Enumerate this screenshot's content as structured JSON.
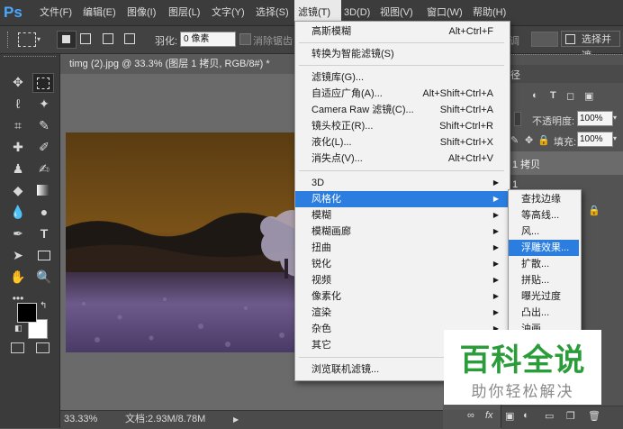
{
  "app": {
    "logo": "Ps"
  },
  "menubar": {
    "items": [
      {
        "label": "文件(F)"
      },
      {
        "label": "编辑(E)"
      },
      {
        "label": "图像(I)"
      },
      {
        "label": "图层(L)"
      },
      {
        "label": "文字(Y)"
      },
      {
        "label": "选择(S)"
      },
      {
        "label": "滤镜(T)"
      },
      {
        "label": "3D(D)"
      },
      {
        "label": "视图(V)"
      },
      {
        "label": "窗口(W)"
      },
      {
        "label": "帮助(H)"
      }
    ]
  },
  "options": {
    "feather_label": "羽化:",
    "feather_value": "0 像素",
    "antialias_label": "消除锯齿",
    "adjust_label": "调",
    "select_mask_button": "选择并遮"
  },
  "document": {
    "tab_title": "timg (2).jpg @ 33.3% (图层 1 拷贝, RGB/8#) *",
    "zoom": "33.33%",
    "doc_info": "文档:2.93M/8.78M"
  },
  "filter_menu": {
    "items": [
      {
        "label": "高斯模糊",
        "shortcut": "Alt+Ctrl+F"
      },
      {
        "label": "转换为智能滤镜(S)",
        "shortcut": ""
      },
      {
        "label": "滤镜库(G)...",
        "shortcut": ""
      },
      {
        "label": "自适应广角(A)...",
        "shortcut": "Alt+Shift+Ctrl+A"
      },
      {
        "label": "Camera Raw 滤镜(C)...",
        "shortcut": "Shift+Ctrl+A"
      },
      {
        "label": "镜头校正(R)...",
        "shortcut": "Shift+Ctrl+R"
      },
      {
        "label": "液化(L)...",
        "shortcut": "Shift+Ctrl+X"
      },
      {
        "label": "消失点(V)...",
        "shortcut": "Alt+Ctrl+V"
      },
      {
        "label": "3D",
        "shortcut": ""
      },
      {
        "label": "风格化",
        "shortcut": ""
      },
      {
        "label": "模糊",
        "shortcut": ""
      },
      {
        "label": "模糊画廊",
        "shortcut": ""
      },
      {
        "label": "扭曲",
        "shortcut": ""
      },
      {
        "label": "锐化",
        "shortcut": ""
      },
      {
        "label": "视频",
        "shortcut": ""
      },
      {
        "label": "像素化",
        "shortcut": ""
      },
      {
        "label": "渲染",
        "shortcut": ""
      },
      {
        "label": "杂色",
        "shortcut": ""
      },
      {
        "label": "其它",
        "shortcut": ""
      },
      {
        "label": "浏览联机滤镜...",
        "shortcut": ""
      }
    ]
  },
  "stylize_submenu": {
    "items": [
      {
        "label": "查找边缘"
      },
      {
        "label": "等高线..."
      },
      {
        "label": "风..."
      },
      {
        "label": "浮雕效果..."
      },
      {
        "label": "扩散..."
      },
      {
        "label": "拼贴..."
      },
      {
        "label": "曝光过度"
      },
      {
        "label": "凸出..."
      },
      {
        "label": "油画..."
      }
    ]
  },
  "layers_panel": {
    "tab_fragment": "径",
    "opacity_label": "不透明度:",
    "opacity_value": "100%",
    "fill_label": "填充:",
    "fill_value": "100%",
    "layer_fragment": "1 拷贝",
    "layer2_fragment": "1"
  },
  "watermark": {
    "title": "百科全说",
    "subtitle": "助你轻松解决"
  },
  "colors": {
    "accent": "#2b7ee0",
    "watermark_green": "#2a9d3a"
  }
}
